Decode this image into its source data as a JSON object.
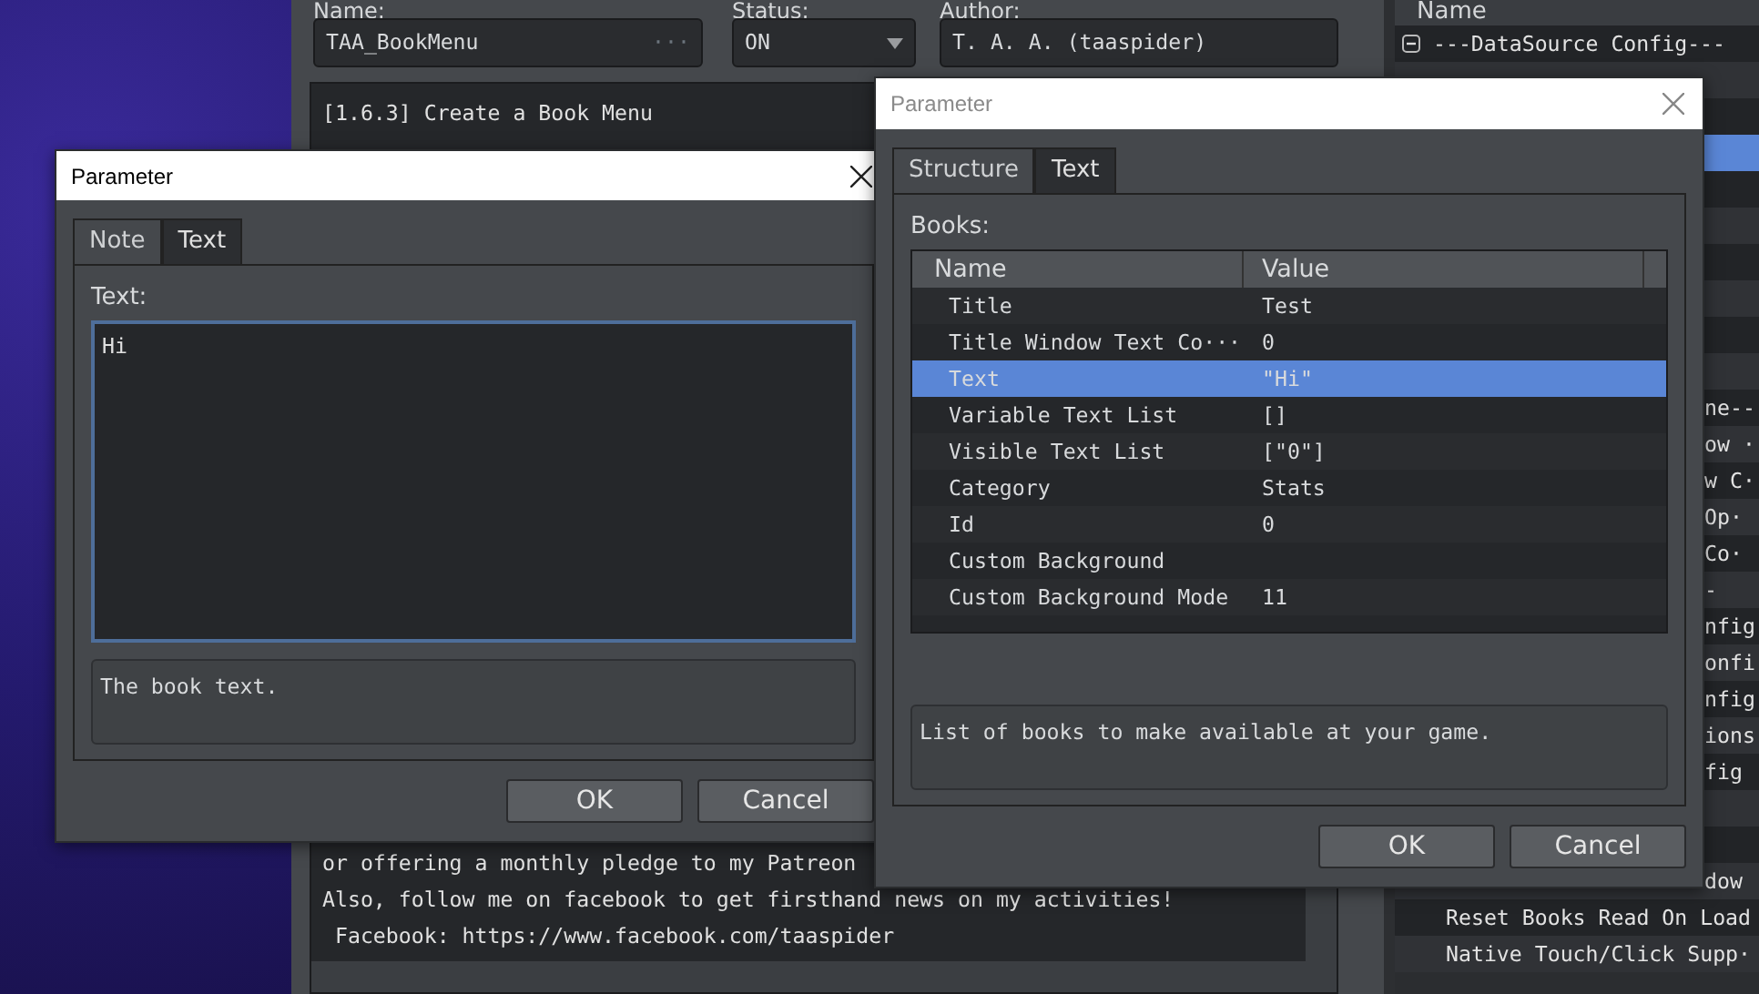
{
  "editor": {
    "name_label": "Name:",
    "name_value": "TAA_BookMenu",
    "name_button": "···",
    "status_label": "Status:",
    "status_value": "ON",
    "author_label": "Author:",
    "author_value": "T. A. A. (taaspider)",
    "note_top": "[1.6.3] Create a Book Menu",
    "note_bottom_lines": [
      "or offering a monthly pledge to my Patreon",
      "Also, follow me on facebook to get firsthand news on my activities!",
      " Facebook: https://www.facebook.com/taaspider"
    ]
  },
  "parameter_list": {
    "header": "Name",
    "rows": [
      {
        "kind": "group",
        "text": "---DataSource Config---",
        "expanded": true,
        "selected": false
      },
      {
        "kind": "item",
        "selected": false
      },
      {
        "kind": "item",
        "selected": false
      },
      {
        "kind": "item",
        "selected": true
      },
      {
        "kind": "item",
        "selected": false
      },
      {
        "kind": "item",
        "selected": false
      },
      {
        "kind": "item",
        "selected": false
      },
      {
        "kind": "item",
        "selected": false
      },
      {
        "kind": "item",
        "selected": false
      },
      {
        "kind": "item",
        "selected": false
      },
      {
        "kind": "clipped",
        "text": "ne--",
        "selected": false
      },
      {
        "kind": "clipped",
        "text": "ow ·",
        "selected": false
      },
      {
        "kind": "clipped",
        "text": "w C·",
        "selected": false
      },
      {
        "kind": "clipped",
        "text": "Op·",
        "selected": false
      },
      {
        "kind": "clipped",
        "text": "Co·",
        "selected": false
      },
      {
        "kind": "clipped",
        "text": "-",
        "selected": false
      },
      {
        "kind": "clipped",
        "text": "nfig",
        "selected": false
      },
      {
        "kind": "clipped",
        "text": "onfi",
        "selected": false
      },
      {
        "kind": "clipped",
        "text": "nfig",
        "selected": false
      },
      {
        "kind": "clipped",
        "text": "ions",
        "selected": false
      },
      {
        "kind": "clipped",
        "text": "fig",
        "selected": false
      },
      {
        "kind": "item",
        "selected": false
      },
      {
        "kind": "item",
        "selected": false
      },
      {
        "kind": "clipped",
        "text": "dow",
        "selected": false
      },
      {
        "kind": "item",
        "text": "Reset Books Read On Load",
        "selected": false
      },
      {
        "kind": "item",
        "text": "Native Touch/Click Supp·",
        "selected": false
      }
    ]
  },
  "dialogs": [
    {
      "kind": "text",
      "title": "Parameter",
      "active": true,
      "tabs": [
        {
          "label": "Note",
          "selected": true
        },
        {
          "label": "Text",
          "selected": false
        }
      ],
      "field_label": "Text:",
      "value": "Hi",
      "description": "The book text.",
      "buttons": [
        "OK",
        "Cancel"
      ]
    },
    {
      "kind": "structure",
      "title": "Parameter",
      "active": false,
      "tabs": [
        {
          "label": "Structure",
          "selected": true
        },
        {
          "label": "Text",
          "selected": false
        }
      ],
      "field_label": "Books:",
      "columns": [
        "Name",
        "Value"
      ],
      "rows": [
        {
          "name": "Title",
          "value": "Test",
          "selected": false
        },
        {
          "name": "Title Window Text Co···",
          "value": "0",
          "selected": false
        },
        {
          "name": "Text",
          "value": "\"Hi\"",
          "selected": true
        },
        {
          "name": "Variable Text List",
          "value": "[]",
          "selected": false
        },
        {
          "name": "Visible Text List",
          "value": "[\"0\"]",
          "selected": false
        },
        {
          "name": "Category",
          "value": "Stats",
          "selected": false
        },
        {
          "name": "Id",
          "value": "0",
          "selected": false
        },
        {
          "name": "Custom Background",
          "selected": false
        },
        {
          "name": "Custom Background Mode",
          "value": "11",
          "selected": false
        }
      ],
      "description": "List of books to make available at your game.",
      "buttons": [
        "OK",
        "Cancel"
      ]
    }
  ]
}
